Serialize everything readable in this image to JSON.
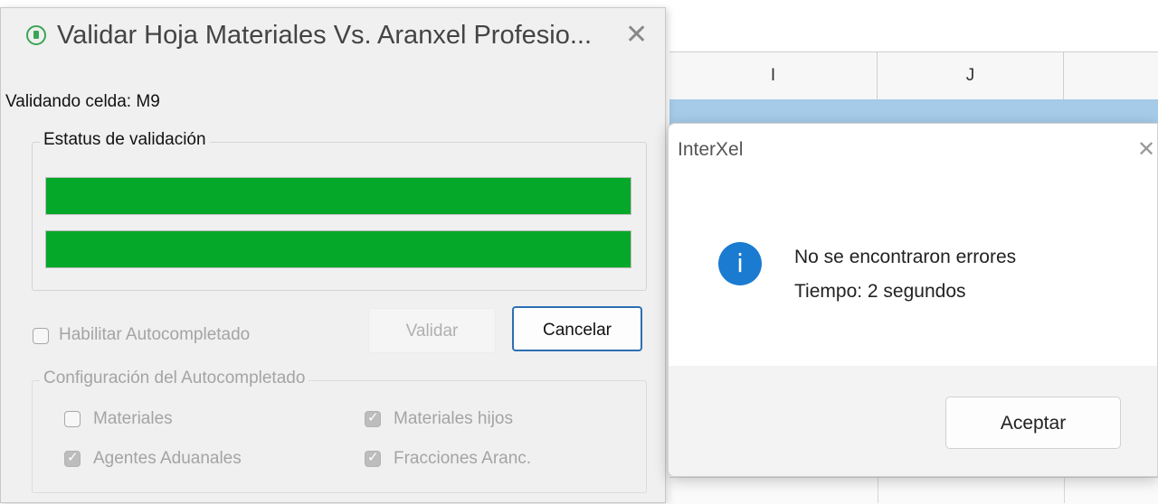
{
  "spreadsheet": {
    "columns": [
      "I",
      "J"
    ]
  },
  "validation_dialog": {
    "title": "Validar Hoja Materiales Vs. Aranxel Profesio...",
    "app_icon": "document-circle-icon",
    "close_icon": "close-icon",
    "status_text": "Validando celda: M9",
    "status_group_label": "Estatus de validación",
    "progress": [
      1.0,
      1.0
    ],
    "progress_color": "#06a82a",
    "enable_autocomplete": {
      "label": "Habilitar Autocompletado",
      "checked": false
    },
    "validar_label": "Validar",
    "cancelar_label": "Cancelar",
    "config_group_label": "Configuración del Autocompletado",
    "options": [
      {
        "label": "Materiales",
        "checked": false
      },
      {
        "label": "Materiales hijos",
        "checked": true
      },
      {
        "label": "Agentes Aduanales",
        "checked": true
      },
      {
        "label": "Fracciones Aranc.",
        "checked": true
      }
    ]
  },
  "message_box": {
    "title": "InterXel",
    "close_icon": "close-icon",
    "icon": "info-icon",
    "icon_glyph": "i",
    "line1": "No se encontraron errores",
    "line2": "Tiempo: 2 segundos",
    "ok_label": "Aceptar",
    "accent_color": "#1a7bd1"
  }
}
